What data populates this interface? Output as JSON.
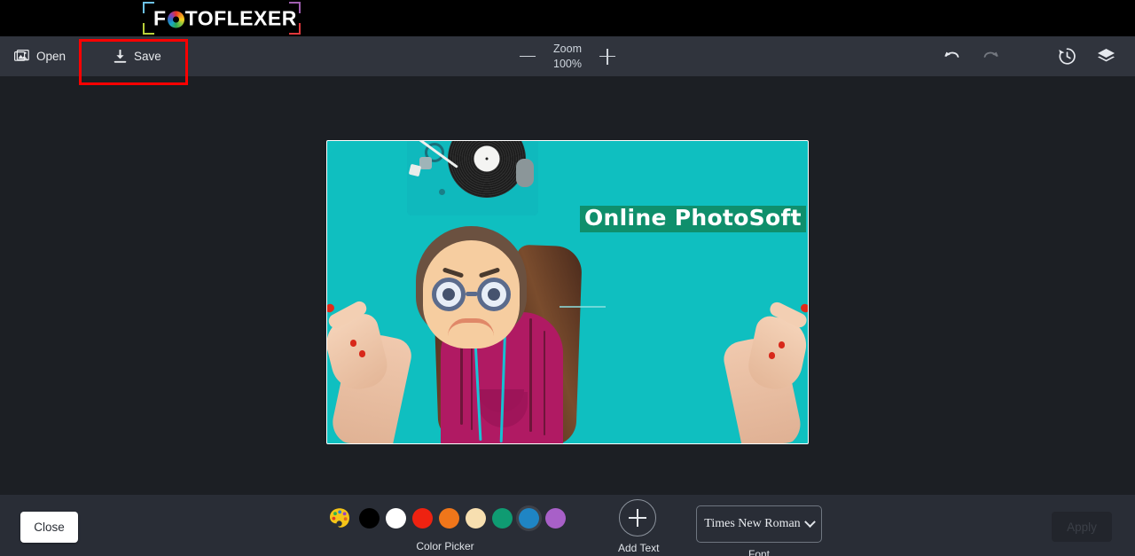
{
  "brand": {
    "name": "FOTOFLEXER",
    "name_before": "F",
    "name_after": "TOFLEXER"
  },
  "toolbar": {
    "open_label": "Open",
    "save_label": "Save",
    "zoom_label": "Zoom",
    "zoom_value": "100%",
    "zoom_out_icon": "minus-icon",
    "zoom_in_icon": "plus-icon",
    "undo_icon": "undo-icon",
    "redo_icon": "redo-icon",
    "history_icon": "history-clock-icon",
    "layers_icon": "layers-icon"
  },
  "highlight": {
    "target": "save-button",
    "color": "#ff0000"
  },
  "canvas": {
    "background_color": "#0fbfc0",
    "text_layer": {
      "text": "Online PhotoSoft",
      "color": "#ffffff",
      "highlight_color": "#0f8f6c"
    },
    "objects": [
      "turntable",
      "woman-pointing",
      "emoji-face-overlay"
    ]
  },
  "bottom": {
    "close_label": "Close",
    "color_picker_label": "Color Picker",
    "palette_icon": "palette-icon",
    "swatches": [
      {
        "name": "black",
        "hex": "#000000",
        "selected": false
      },
      {
        "name": "white",
        "hex": "#ffffff",
        "selected": false
      },
      {
        "name": "red",
        "hex": "#ee2211",
        "selected": false
      },
      {
        "name": "orange",
        "hex": "#f0761a",
        "selected": false
      },
      {
        "name": "cream",
        "hex": "#f7dfb0",
        "selected": false
      },
      {
        "name": "teal",
        "hex": "#0f9b72",
        "selected": false
      },
      {
        "name": "blue",
        "hex": "#1f85c4",
        "selected": true
      },
      {
        "name": "purple",
        "hex": "#a860c8",
        "selected": false
      }
    ],
    "add_text_label": "Add Text",
    "add_text_icon": "plus-circle-icon",
    "font_label": "Font",
    "font_value": "Times New Roman",
    "font_chevron_icon": "chevron-down-icon",
    "apply_label": "Apply",
    "apply_disabled": true
  }
}
